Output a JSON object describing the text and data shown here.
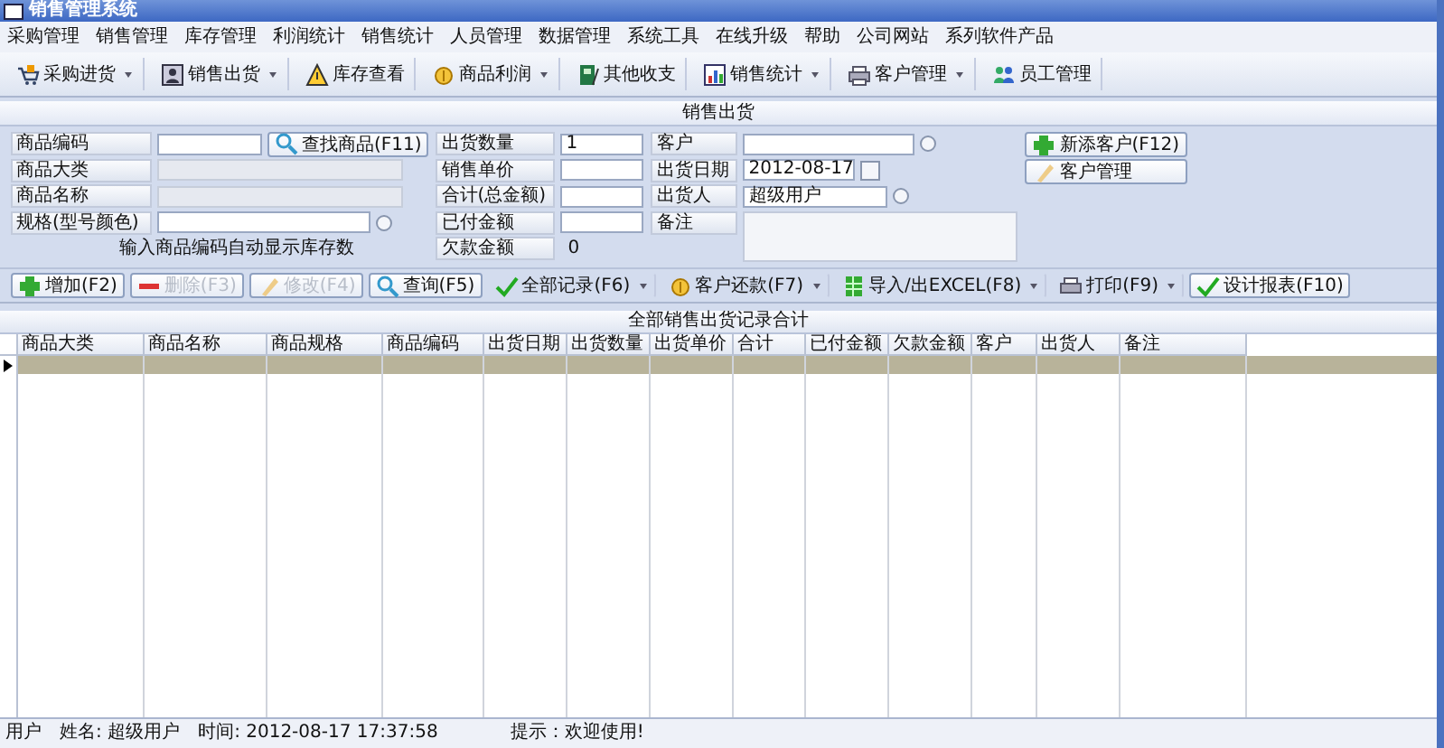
{
  "window": {
    "title": "销售管理系统"
  },
  "menu": [
    "采购管理",
    "销售管理",
    "库存管理",
    "利润统计",
    "销售统计",
    "人员管理",
    "数据管理",
    "系统工具",
    "在线升级",
    "帮助",
    "公司网站",
    "系列软件产品"
  ],
  "toolbar": [
    {
      "label": "采购进货",
      "dropdown": true
    },
    {
      "label": "销售出货",
      "dropdown": true
    },
    {
      "label": "库存查看",
      "dropdown": false
    },
    {
      "label": "商品利润",
      "dropdown": true
    },
    {
      "label": "其他收支",
      "dropdown": false
    },
    {
      "label": "销售统计",
      "dropdown": true
    },
    {
      "label": "客户管理",
      "dropdown": true
    },
    {
      "label": "员工管理",
      "dropdown": false
    }
  ],
  "form": {
    "title": "销售出货",
    "left": [
      {
        "label": "商品编码",
        "kind": "search",
        "button": "查找商品(F11)"
      },
      {
        "label": "商品大类",
        "kind": "readonly"
      },
      {
        "label": "商品名称",
        "kind": "readonly"
      },
      {
        "label": "规格(型号颜色)",
        "kind": "select"
      }
    ],
    "hint": "输入商品编码自动显示库存数",
    "middle": [
      {
        "label": "出货数量",
        "kind": "input",
        "value": "1"
      },
      {
        "label": "销售单价",
        "kind": "input"
      },
      {
        "label": "合计(总金额)",
        "kind": "input"
      },
      {
        "label": "已付金额",
        "kind": "input"
      },
      {
        "label": "欠款金额",
        "kind": "text",
        "value": "0"
      }
    ],
    "right": [
      {
        "label": "客户",
        "kind": "select"
      },
      {
        "label": "出货日期",
        "kind": "date",
        "value": "2012-08-17"
      },
      {
        "label": "出货人",
        "kind": "select",
        "value": "超级用户"
      },
      {
        "label": "备注",
        "kind": "memo"
      }
    ],
    "side_buttons": [
      "新添客户(F12)",
      "客户管理"
    ]
  },
  "actions": [
    {
      "label": "增加(F2)",
      "kind": "boxed",
      "disabled": false,
      "dropdown": false
    },
    {
      "label": "删除(F3)",
      "kind": "boxed",
      "disabled": true,
      "dropdown": false
    },
    {
      "label": "修改(F4)",
      "kind": "boxed",
      "disabled": true,
      "dropdown": false
    },
    {
      "label": "查询(F5)",
      "kind": "boxed",
      "disabled": false,
      "dropdown": false
    },
    {
      "label": "全部记录(F6)",
      "kind": "flat",
      "disabled": false,
      "dropdown": true
    },
    {
      "label": "客户还款(F7)",
      "kind": "flat",
      "disabled": false,
      "dropdown": true
    },
    {
      "label": "导入/出EXCEL(F8)",
      "kind": "flat",
      "disabled": false,
      "dropdown": true
    },
    {
      "label": "打印(F9)",
      "kind": "flat",
      "disabled": false,
      "dropdown": true
    },
    {
      "label": "设计报表(F10)",
      "kind": "boxed",
      "disabled": false,
      "dropdown": false
    }
  ],
  "grid": {
    "title": "全部销售出货记录合计",
    "columns": [
      "商品大类",
      "商品名称",
      "商品规格",
      "商品编码",
      "出货日期",
      "出货数量",
      "出货单价",
      "合计",
      "已付金额",
      "欠款金额",
      "客户",
      "出货人",
      "备注"
    ],
    "rows": [
      {
        "selected": true
      }
    ]
  },
  "status_bar": [
    "用户",
    "姓名: 超级用户",
    "时间: 2012-08-17 17:37:58",
    "提示：欢迎使用!"
  ]
}
